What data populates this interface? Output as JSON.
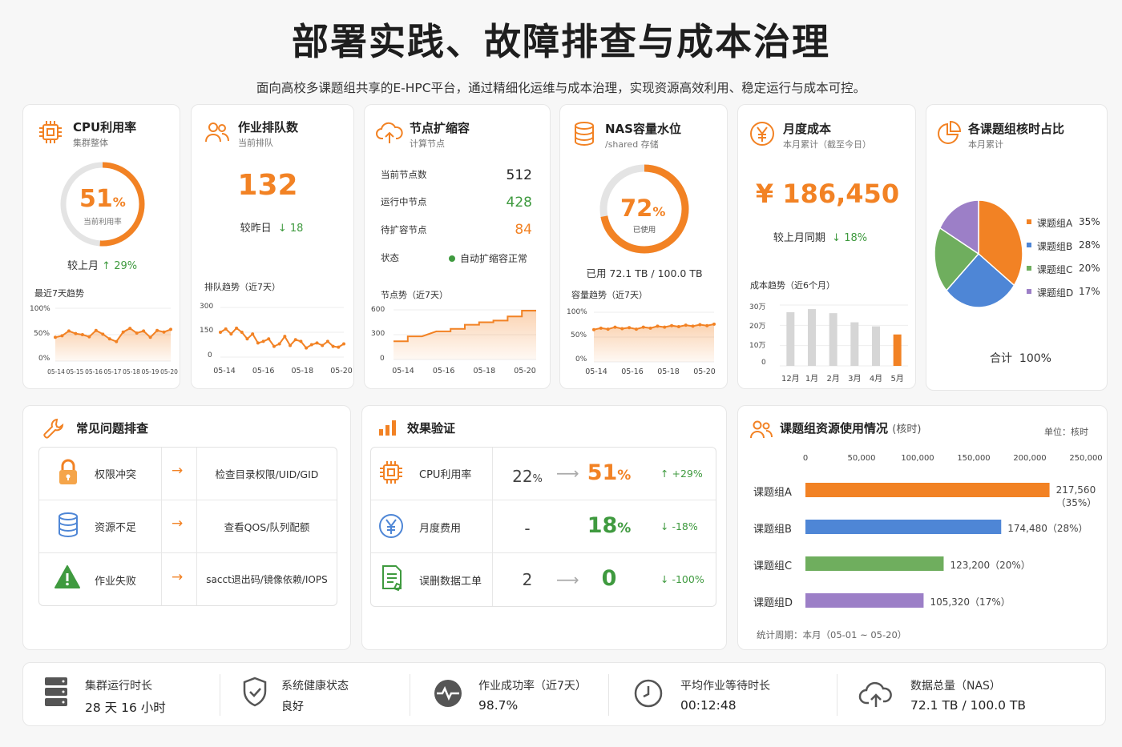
{
  "title": "部署实践、故障排查与成本治理",
  "subtitle": "面向高校多课题组共享的E-HPC平台，通过精细化运维与成本治理，实现资源高效利用、稳定运行与成本可控。",
  "cpu": {
    "title": "CPU利用率",
    "sub": "集群整体",
    "value": "51",
    "unit": "%",
    "value_label": "当前利用率",
    "percent": 51,
    "compare_label": "较上月",
    "compare_value": "29%",
    "trend_title": "最近7天趋势",
    "y_ticks": [
      "100%",
      "50%",
      "0%"
    ],
    "x_ticks": [
      "05-14",
      "05-15",
      "05-16",
      "05-17",
      "05-18",
      "05-19",
      "05-20"
    ],
    "chart_data": {
      "type": "area",
      "x": [
        "05-14",
        "05-15",
        "05-16",
        "05-17",
        "05-18",
        "05-19",
        "05-20"
      ],
      "values": [
        45,
        48,
        57,
        52,
        50,
        46,
        58,
        51,
        42,
        37,
        55,
        62,
        53,
        57,
        45,
        58,
        55,
        60
      ],
      "ylim": [
        0,
        100
      ]
    }
  },
  "queue": {
    "title": "作业排队数",
    "sub": "当前排队",
    "value": "132",
    "compare_label": "较昨日",
    "compare_value": "18",
    "trend_title": "排队趋势（近7天）",
    "y_ticks": [
      "300",
      "150",
      "0"
    ],
    "x_ticks": [
      "05-14",
      "05-16",
      "05-18",
      "05-20"
    ],
    "chart_data": {
      "type": "line",
      "values": [
        150,
        170,
        140,
        175,
        150,
        110,
        140,
        85,
        95,
        110,
        65,
        80,
        125,
        70,
        105,
        95,
        55,
        75,
        85,
        70,
        95,
        65,
        60,
        80
      ],
      "ylim": [
        0,
        300
      ]
    }
  },
  "nodes": {
    "title": "节点扩缩容",
    "sub": "计算节点",
    "rows": [
      {
        "label": "当前节点数",
        "value": "512"
      },
      {
        "label": "运行中节点",
        "value": "428"
      },
      {
        "label": "待扩容节点",
        "value": "84"
      }
    ],
    "status_label": "状态",
    "status_value": "自动扩缩容正常",
    "status_color": "#3f9a3f",
    "trend_title": "节点势（近7天）",
    "y_ticks": [
      "600",
      "300",
      "0"
    ],
    "x_ticks": [
      "05-14",
      "05-16",
      "05-18",
      "05-20"
    ],
    "chart_data": {
      "type": "area",
      "values": [
        220,
        220,
        280,
        280,
        280,
        340,
        340,
        340,
        370,
        370,
        420,
        420,
        450,
        450,
        470,
        470,
        520,
        520,
        590,
        590
      ],
      "ylim": [
        0,
        600
      ]
    }
  },
  "nas": {
    "title": "NAS容量水位",
    "sub": "/shared 存储",
    "value": "72",
    "unit": "%",
    "value_label": "已使用",
    "percent": 72,
    "used_text": "已用 72.1 TB / 100.0 TB",
    "trend_title": "容量趋势（近7天）",
    "y_ticks": [
      "100%",
      "50%",
      "0%"
    ],
    "x_ticks": [
      "05-14",
      "05-16",
      "05-18",
      "05-20"
    ],
    "chart_data": {
      "type": "area",
      "values": [
        65,
        68,
        66,
        70,
        67,
        69,
        66,
        70,
        68,
        72,
        70,
        73,
        71,
        74,
        72,
        75,
        73,
        76
      ],
      "ylim": [
        0,
        100
      ]
    }
  },
  "cost": {
    "title": "月度成本",
    "sub": "本月累计（截至今日）",
    "value": "¥ 186,450",
    "compare_label": "较上月同期",
    "compare_value": "18%",
    "trend_title": "成本趋势（近6个月）",
    "y_ticks": [
      "30万",
      "20万",
      "10万",
      "0"
    ],
    "chart_data": {
      "type": "bar",
      "categories": [
        "12月",
        "1月",
        "2月",
        "3月",
        "4月",
        "5月"
      ],
      "values": [
        26.5,
        28,
        26,
        21.5,
        19.5,
        15.5
      ],
      "ylim": [
        0,
        30
      ]
    }
  },
  "share": {
    "title": "各课题组核时占比",
    "sub": "本月累计",
    "total_label": "合计",
    "total_value": "100%",
    "chart_data": {
      "type": "pie",
      "series": [
        {
          "name": "课题组A",
          "value": 35,
          "label": "35%",
          "color": "#f28224"
        },
        {
          "name": "课题组B",
          "value": 28,
          "label": "28%",
          "color": "#4e86d6"
        },
        {
          "name": "课题组C",
          "value": 20,
          "label": "20%",
          "color": "#6fae5e"
        },
        {
          "name": "课题组D",
          "value": 17,
          "label": "17%",
          "color": "#9c7fc7"
        }
      ]
    }
  },
  "troubleshoot": {
    "title": "常见问题排查",
    "rows": [
      {
        "icon": "lock-icon",
        "problem": "权限冲突",
        "action": "检查目录权限/UID/GID"
      },
      {
        "icon": "database-icon",
        "problem": "资源不足",
        "action": "查看QOS/队列配额"
      },
      {
        "icon": "warning-icon",
        "problem": "作业失败",
        "action": "sacct退出码/镜像依赖/IOPS"
      }
    ]
  },
  "effect": {
    "title": "效果验证",
    "rows": [
      {
        "icon": "cpu-icon",
        "label": "CPU利用率",
        "before": "22",
        "before_unit": "%",
        "after": "51",
        "after_unit": "%",
        "after_color": "#f28224",
        "delta_dir": "up",
        "delta": "+29%"
      },
      {
        "icon": "yen-icon",
        "label": "月度费用",
        "before": "-",
        "before_unit": "",
        "after": "18",
        "after_unit": "%",
        "after_color": "#3f9a3f",
        "delta_dir": "down",
        "delta": "-18%"
      },
      {
        "icon": "document-icon",
        "label": "误删数据工单",
        "before": "2",
        "before_unit": "",
        "after": "0",
        "after_unit": "",
        "after_color": "#3f9a3f",
        "delta_dir": "down",
        "delta": "-100%"
      }
    ]
  },
  "usage": {
    "title": "课题组资源使用情况",
    "title_unit": "(核时)",
    "unit_label": "单位：核时",
    "x_ticks": [
      "0",
      "50,000",
      "100,000",
      "150,000",
      "200,000",
      "250,000"
    ],
    "period": "统计周期：本月（05-01 ~ 05-20）",
    "chart_data": {
      "type": "bar",
      "xlim": [
        0,
        250000
      ],
      "series": [
        {
          "name": "课题组A",
          "value": 217560,
          "label": "217,560（35%）",
          "color": "#f28224"
        },
        {
          "name": "课题组B",
          "value": 174480,
          "label": "174,480（28%）",
          "color": "#4e86d6"
        },
        {
          "name": "课题组C",
          "value": 123200,
          "label": "123,200（20%）",
          "color": "#6fae5e"
        },
        {
          "name": "课题组D",
          "value": 105320,
          "label": "105,320（17%）",
          "color": "#9c7fc7"
        }
      ]
    }
  },
  "bottom": [
    {
      "icon": "server-icon",
      "label": "集群运行时长",
      "value": "28 天 16 小时",
      "color": "#222"
    },
    {
      "icon": "shield-icon",
      "label": "系统健康状态",
      "value": "良好",
      "color": "#3f9a3f"
    },
    {
      "icon": "pulse-icon",
      "label": "作业成功率（近7天）",
      "value": "98.7%",
      "color": "#3f9a3f"
    },
    {
      "icon": "clock-icon",
      "label": "平均作业等待时长",
      "value": "00:12:48",
      "color": "#222"
    },
    {
      "icon": "cloud-icon",
      "label": "数据总量（NAS）",
      "value": "72.1 TB / 100.0 TB",
      "color": "#222"
    }
  ],
  "colors": {
    "accent": "#f28224",
    "good": "#3f9a3f",
    "blue": "#4e86d6",
    "purple": "#9c7fc7",
    "text": "#222"
  }
}
